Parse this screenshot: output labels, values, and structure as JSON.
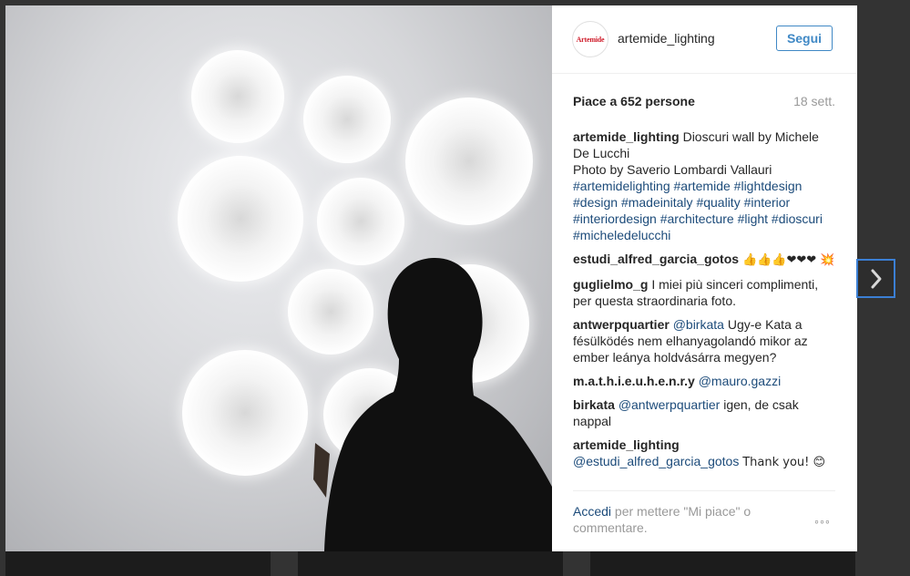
{
  "post": {
    "username": "artemide_lighting",
    "avatar_text": "Artemide",
    "follow_label": "Segui",
    "likes_text": "Piace a 652 persone",
    "age_text": "18 sett."
  },
  "caption": {
    "user": "artemide_lighting",
    "text1": "Dioscuri wall by Michele De Lucchi",
    "text2": "Photo by Saverio Lombardi Vallauri",
    "tags": [
      "#artemidelighting",
      "#artemide",
      "#lightdesign",
      "#design",
      "#madeinitaly",
      "#quality",
      "#interior",
      "#interiordesign",
      "#architecture",
      "#light",
      "#dioscuri",
      "#micheledelucchi"
    ]
  },
  "comments": [
    {
      "user": "estudi_alfred_garcia_gotos",
      "text": "👍👍👍❤❤❤ 💥"
    },
    {
      "user": "guglielmo_g",
      "text": "I miei più sinceri complimenti, per questa straordinaria foto."
    },
    {
      "user": "antwerpquartier",
      "mention": "@birkata",
      "text": "Ugy-e Kata a fésülködés nem elhanyagolandó mikor az ember leánya holdvásárra megyen?"
    },
    {
      "user": "m.a.t.h.i.e.u.h.e.n.r.y",
      "mention": "@mauro.gazzi",
      "text": ""
    },
    {
      "user": "birkata",
      "mention": "@antwerpquartier",
      "text": "igen, de csak nappal"
    },
    {
      "user": "artemide_lighting",
      "mention": "@estudi_alfred_garcia_gotos",
      "text": "Thank you! 😊"
    }
  ],
  "footer": {
    "login_label": "Accedi",
    "rest_text": "per mettere \"Mi piace\" o commentare.",
    "more_label": "◦◦◦"
  },
  "icons": {
    "next": "chevron-right-icon"
  },
  "colors": {
    "accent": "#3f88c5",
    "link": "#1c4b7a",
    "brand": "#d0202e"
  }
}
